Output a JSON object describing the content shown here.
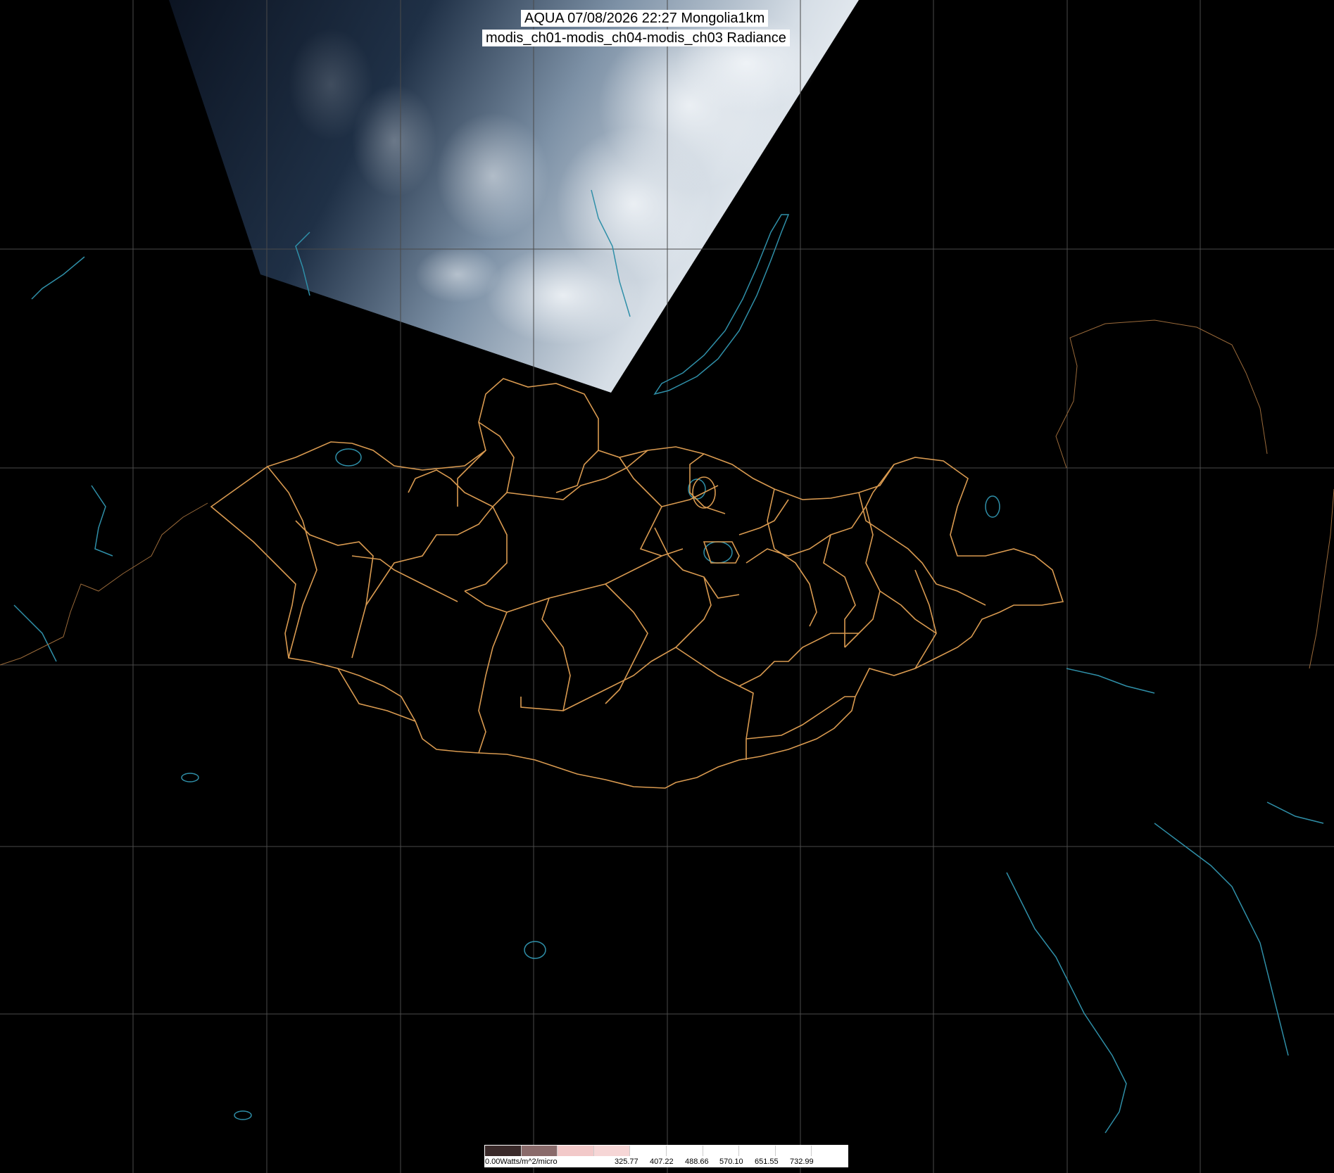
{
  "map": {
    "title_line1": "AQUA 07/08/2026 22:27 Mongolia1km",
    "title_line2": "modis_ch01-modis_ch04-modis_ch03 Radiance",
    "colors": {
      "background": "#000000",
      "grid": "#4a4a4a",
      "admin_borders": "#d99a50",
      "coastlines": "#2f8fa8",
      "cloud": "#dfe7ee"
    }
  },
  "legend": {
    "unit_label": "0.00Watts/m^2/micro",
    "tick_labels": [
      "325.77",
      "407.22",
      "488.66",
      "570.10",
      "651.55",
      "732.99"
    ],
    "segment_colors": [
      "#3a2a2a",
      "#8a6b6b",
      "#f2c9c9",
      "#f6d6d6",
      "#ffffff",
      "#ffffff",
      "#ffffff",
      "#ffffff",
      "#ffffff",
      "#ffffff"
    ]
  }
}
